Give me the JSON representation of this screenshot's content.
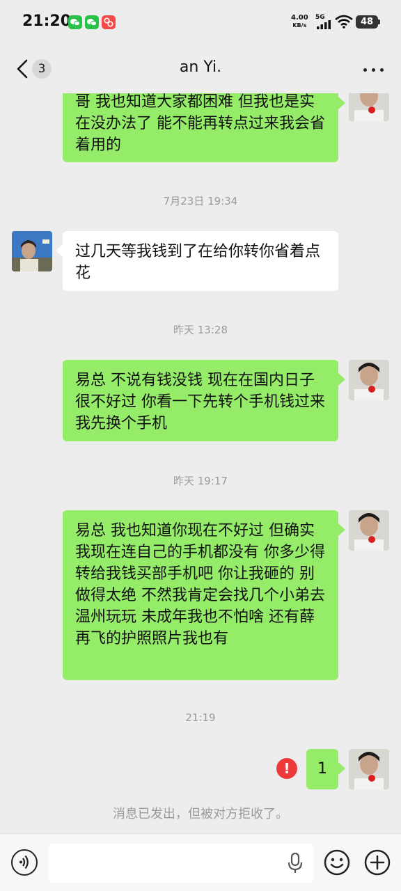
{
  "status_bar": {
    "time": "21:20",
    "speed_value": "4.00",
    "speed_unit": "KB/s",
    "network": "5G",
    "battery": "48",
    "icons": [
      "wechat-icon",
      "wechat-icon",
      "app-icon",
      "signal-icon",
      "wifi-icon",
      "battery-icon"
    ]
  },
  "header": {
    "unread_count": "3",
    "title": "an Yi.",
    "icons": [
      "chevron-left-icon",
      "more-icon"
    ]
  },
  "messages": [
    {
      "sender": "me",
      "text": "哥 我也知道大家都困难 但我也是实在没办法了 能不能再转点过来我会省着用的"
    },
    {
      "time": "7月23日 19:34"
    },
    {
      "sender": "other",
      "text": "过几天等我钱到了在给你转你省着点花"
    },
    {
      "time": "昨天 13:28"
    },
    {
      "sender": "me",
      "text": "易总 不说有钱没钱 现在在国内日子很不好过 你看一下先转个手机钱过来 我先换个手机"
    },
    {
      "time": "昨天 19:17"
    },
    {
      "sender": "me",
      "text": "易总 我也知道你现在不好过 但确实我现在连自己的手机都没有 你多少得转给我钱买部手机吧 你让我砸的 别做得太绝 不然我肯定会找几个小弟去温州玩玩 未成年我也不怕啥 还有薛再飞的护照照片我也有"
    },
    {
      "time": "21:19"
    },
    {
      "sender": "me",
      "text": "1",
      "failed": true
    }
  ],
  "rejected_notice": "消息已发出，但被对方拒收了。",
  "input_bar": {
    "placeholder": "",
    "icons": [
      "voice-icon",
      "mic-icon",
      "emoji-icon",
      "plus-icon"
    ]
  },
  "colors": {
    "background": "#ededed",
    "my_bubble": "#95ec69",
    "their_bubble": "#ffffff",
    "error": "#ee3a3a"
  }
}
